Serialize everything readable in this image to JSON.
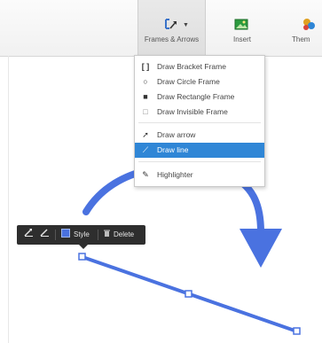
{
  "toolbar": {
    "faded_label": "",
    "frames_arrows_label": "Frames & Arrows",
    "insert_label": "Insert",
    "theme_label": "Them"
  },
  "menu": {
    "items": [
      {
        "icon": "bracket-frame-icon",
        "glyph": "[ ]",
        "label": "Draw Bracket Frame"
      },
      {
        "icon": "circle-frame-icon",
        "glyph": "○",
        "label": "Draw Circle Frame"
      },
      {
        "icon": "rectangle-frame-icon",
        "glyph": "■",
        "label": "Draw Rectangle Frame"
      },
      {
        "icon": "invisible-frame-icon",
        "glyph": "□",
        "label": "Draw Invisible Frame"
      },
      {
        "icon": "arrow-icon",
        "glyph": "➚",
        "label": "Draw arrow"
      },
      {
        "icon": "line-icon",
        "glyph": "⟋",
        "label": "Draw line"
      },
      {
        "icon": "highlighter-icon",
        "glyph": "✎",
        "label": "Highlighter"
      }
    ],
    "active_index": 5
  },
  "selection_toolbar": {
    "style_label": "Style",
    "delete_label": "Delete"
  },
  "colors": {
    "accent": "#2f86d6",
    "shape_blue": "#4a72e0"
  }
}
